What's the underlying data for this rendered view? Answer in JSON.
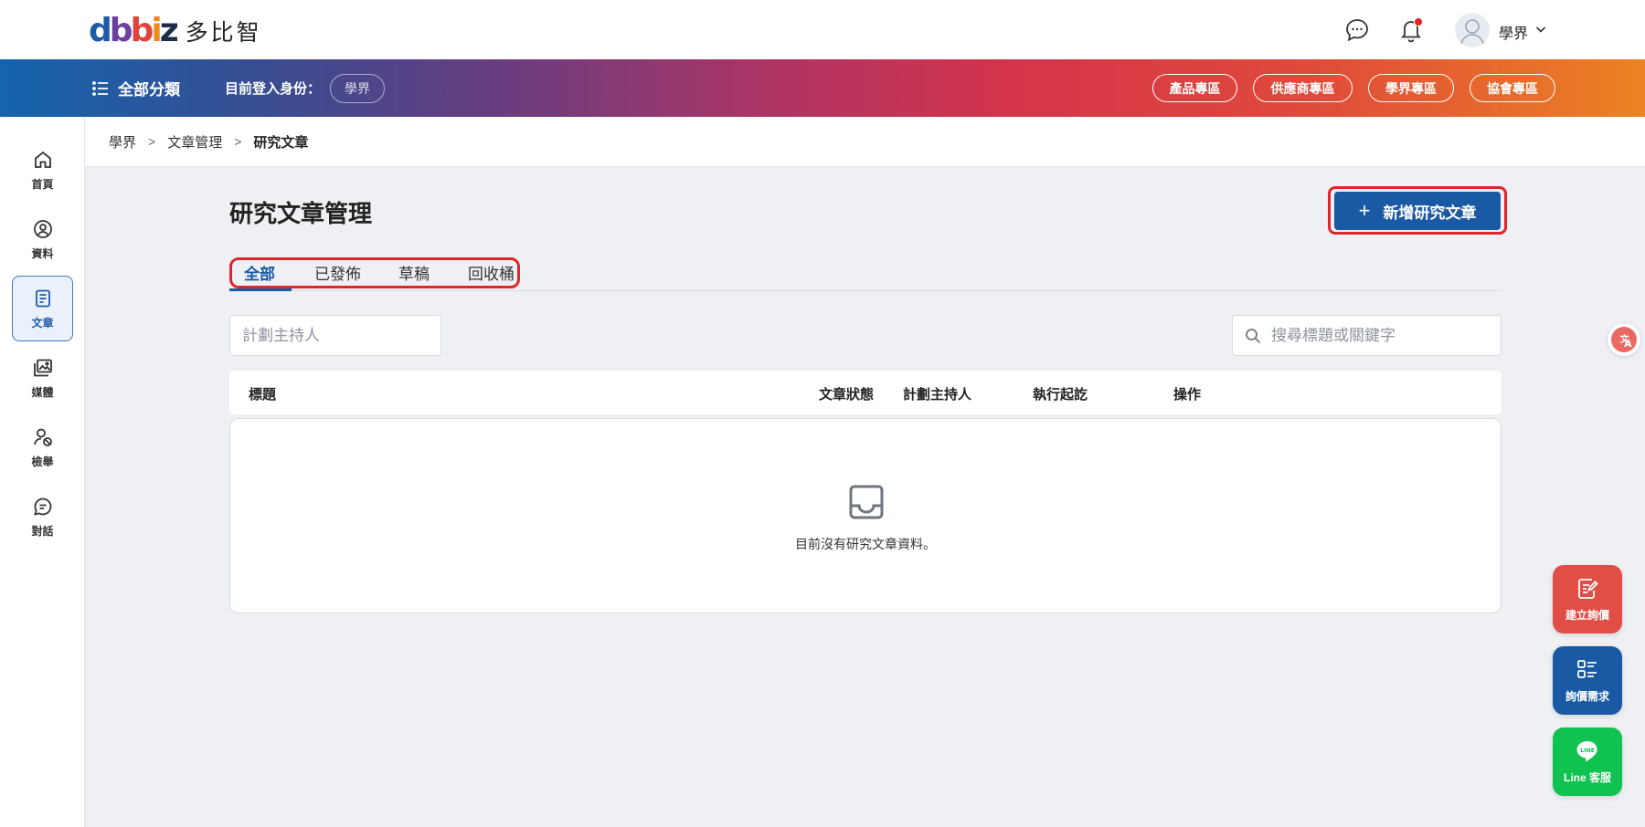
{
  "header": {
    "logo_mark": "dbbiz",
    "logo_name": "多比智",
    "user_name": "學界",
    "icons": [
      "chat-icon",
      "bell-icon",
      "avatar",
      "chevron-down-icon"
    ]
  },
  "navbar": {
    "all_categories": "全部分類",
    "identity_label": "目前登入身份：",
    "identity_value": "學界",
    "zones": [
      "產品專區",
      "供應商專區",
      "學界專區",
      "協會專區"
    ]
  },
  "sidebar": {
    "items": [
      {
        "label": "首頁",
        "icon": "home-icon"
      },
      {
        "label": "資料",
        "icon": "user-circle-icon"
      },
      {
        "label": "文章",
        "icon": "article-icon",
        "active": true
      },
      {
        "label": "媒體",
        "icon": "media-icon"
      },
      {
        "label": "檢舉",
        "icon": "report-user-icon"
      },
      {
        "label": "對話",
        "icon": "chat-icon"
      }
    ]
  },
  "breadcrumb": [
    "學界",
    "文章管理",
    "研究文章"
  ],
  "main": {
    "title": "研究文章管理",
    "add_button": "新增研究文章",
    "tabs": [
      "全部",
      "已發佈",
      "草稿",
      "回收桶"
    ],
    "active_tab": "全部",
    "host_filter_placeholder": "計劃主持人",
    "search_placeholder": "搜尋標題或關鍵字",
    "columns": [
      "標題",
      "文章狀態",
      "計劃主持人",
      "執行起訖",
      "操作"
    ],
    "empty_text": "目前沒有研究文章資料。"
  },
  "floating": {
    "inquiry": "建立詢價",
    "needs": "詢價需求",
    "line": "Line 客服",
    "line_badge": "LINE"
  },
  "colors": {
    "primary": "#1a5aa5",
    "highlight": "#e0262b",
    "inquiry": "#e04e46",
    "line": "#10c24f"
  }
}
